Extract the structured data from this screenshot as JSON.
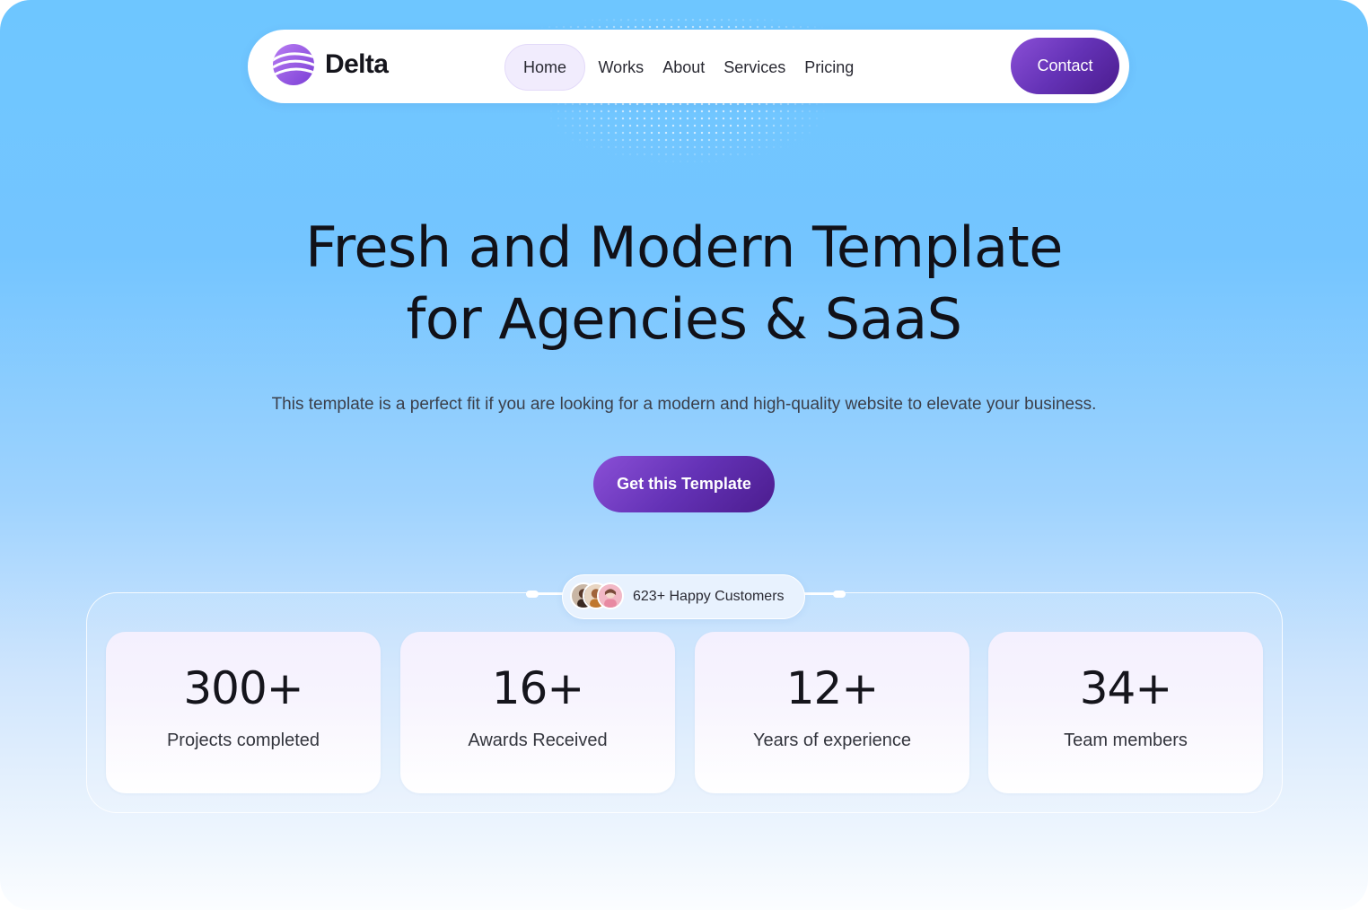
{
  "brand": {
    "name": "Delta"
  },
  "nav": {
    "links": [
      {
        "label": "Home",
        "active": true
      },
      {
        "label": "Works",
        "active": false
      },
      {
        "label": "About",
        "active": false
      },
      {
        "label": "Services",
        "active": false
      },
      {
        "label": "Pricing",
        "active": false
      }
    ],
    "contact_label": "Contact"
  },
  "hero": {
    "title_line1": "Fresh and Modern Template",
    "title_line2": "for Agencies & SaaS",
    "subtitle": "This template is a perfect fit if you are looking for a modern and high-quality website to elevate your business.",
    "cta_label": "Get this Template"
  },
  "customers": {
    "text": "623+ Happy Customers"
  },
  "stats": [
    {
      "value": "300+",
      "label": "Projects completed"
    },
    {
      "value": "16+",
      "label": "Awards Received"
    },
    {
      "value": "12+",
      "label": "Years of experience"
    },
    {
      "value": "34+",
      "label": "Team members"
    }
  ],
  "colors": {
    "accent_purple": "#6432b6",
    "sky_blue": "#6ec6ff",
    "nav_active_bg": "#f1ecfd"
  }
}
